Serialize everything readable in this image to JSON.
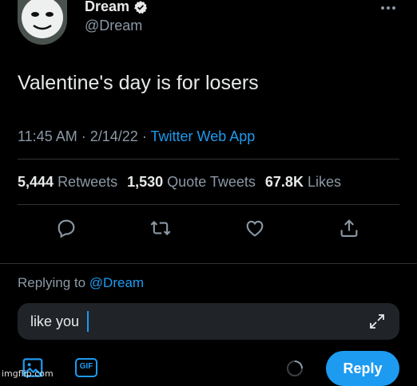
{
  "tweet": {
    "author_name": "Dream",
    "author_handle": "@Dream",
    "text": "Valentine's day is for losers",
    "time": "11:45 AM",
    "date": "2/14/22",
    "source": "Twitter Web App",
    "separator": "·",
    "stats": {
      "retweets_count": "5,444",
      "retweets_label": "Retweets",
      "quotes_count": "1,530",
      "quotes_label": "Quote Tweets",
      "likes_count": "67.8K",
      "likes_label": "Likes"
    }
  },
  "reply": {
    "replying_prefix": "Replying to",
    "replying_mention": "@Dream",
    "input_value": "like you",
    "button_label": "Reply"
  },
  "toolbar": {
    "gif_label": "GIF"
  },
  "watermark": "imgflip.com",
  "colors": {
    "background": "#000000",
    "text": "#e7e9ea",
    "muted": "#8b98a5",
    "accent": "#1d9bf0",
    "input_bg": "#202327"
  },
  "icons": [
    "verified-icon",
    "more-icon",
    "reply-icon",
    "retweet-icon",
    "like-icon",
    "share-icon",
    "expand-icon",
    "image-icon",
    "gif-icon",
    "progress-icon"
  ]
}
